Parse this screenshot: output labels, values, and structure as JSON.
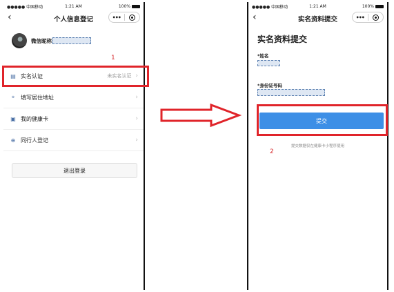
{
  "left": {
    "status": {
      "carrier": "●●●●● 中国移动 ",
      "time": "1:21 AM",
      "battery": "100%"
    },
    "title": "个人信息登记",
    "nickname_label": "微信昵称",
    "step_number": "1",
    "menu": [
      {
        "icon": "id-card-icon",
        "label": "实名认证",
        "status": "未实名认证"
      },
      {
        "icon": "location-pin-icon",
        "label": "填写居住地址",
        "status": ""
      },
      {
        "icon": "health-card-icon",
        "label": "我的健康卡",
        "status": ""
      },
      {
        "icon": "add-circle-icon",
        "label": "同行人登记",
        "status": ""
      }
    ],
    "logout_label": "退出登录"
  },
  "right": {
    "status": {
      "carrier": "●●●●● 中国移动 ",
      "time": "1:21 AM",
      "battery": "100%"
    },
    "title": "实名资料提交",
    "form_title": "实名资料提交",
    "name_label": "*姓名",
    "id_label": "*身份证号码",
    "submit_label": "提交",
    "note": "提交数据仅在健康卡小程序使用",
    "step_number": "2"
  },
  "colors": {
    "highlight": "#e0242a",
    "submit": "#3d8fe6",
    "arrow": "#e0242a"
  }
}
